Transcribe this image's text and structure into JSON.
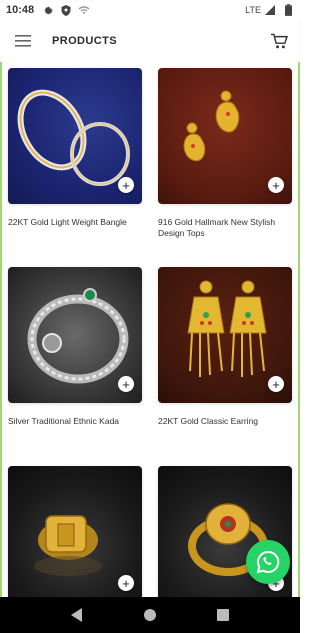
{
  "status_bar": {
    "time": "10:48",
    "network": "LTE"
  },
  "app_bar": {
    "title": "PRODUCTS"
  },
  "products": [
    {
      "name": "22KT  Gold Light Weight Bangle"
    },
    {
      "name": "916 Gold Hallmark New Stylish Design Tops"
    },
    {
      "name": "Silver Traditional Ethnic Kada"
    },
    {
      "name": "22KT Gold Classic Earring"
    },
    {
      "name": ""
    },
    {
      "name": ""
    }
  ],
  "add_button_symbol": "+",
  "colors": {
    "accent_green": "#9fd86b",
    "whatsapp": "#25d366"
  }
}
